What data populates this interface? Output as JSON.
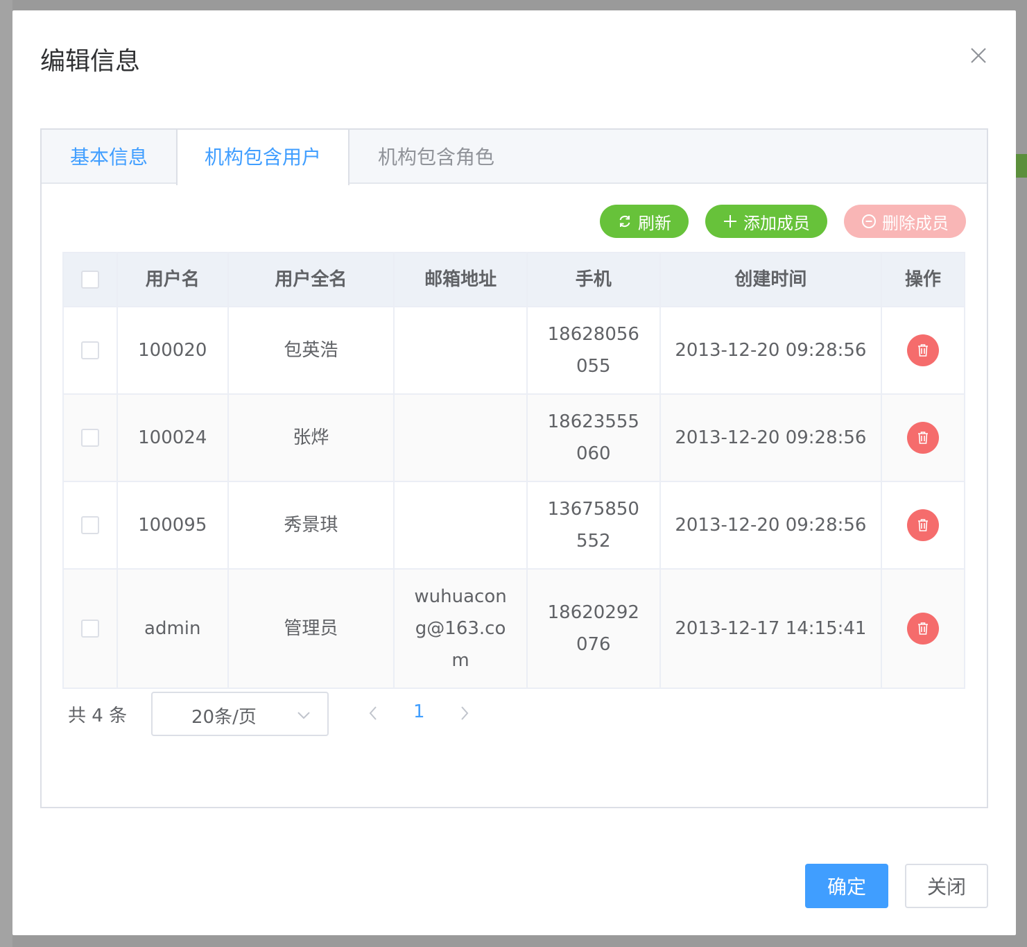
{
  "dialog": {
    "title": "编辑信息"
  },
  "tabs": [
    {
      "label": "基本信息"
    },
    {
      "label": "机构包含用户"
    },
    {
      "label": "机构包含角色"
    }
  ],
  "toolbar": {
    "refresh_label": "刷新",
    "add_label": "添加成员",
    "delete_label": "删除成员"
  },
  "table": {
    "headers": [
      "用户名",
      "用户全名",
      "邮箱地址",
      "手机",
      "创建时间",
      "操作"
    ],
    "rows": [
      {
        "username": "100020",
        "fullname": "包英浩",
        "email": "",
        "phone": "18628056055",
        "created": "2013-12-20 09:28:56"
      },
      {
        "username": "100024",
        "fullname": "张烨",
        "email": "",
        "phone": "18623555060",
        "created": "2013-12-20 09:28:56"
      },
      {
        "username": "100095",
        "fullname": "秀景琪",
        "email": "",
        "phone": "13675850552",
        "created": "2013-12-20 09:28:56"
      },
      {
        "username": "admin",
        "fullname": "管理员",
        "email": "wuhuacong@163.com",
        "phone": "18620292076",
        "created": "2013-12-17 14:15:41"
      }
    ]
  },
  "pagination": {
    "total": "共 4 条",
    "page_size": "20条/页",
    "current_page": "1"
  },
  "footer": {
    "ok_label": "确定",
    "close_label": "关闭"
  },
  "colors": {
    "primary": "#409eff",
    "success": "#67c23a",
    "danger": "#f56c6c",
    "danger_light": "#f9b6b6"
  }
}
